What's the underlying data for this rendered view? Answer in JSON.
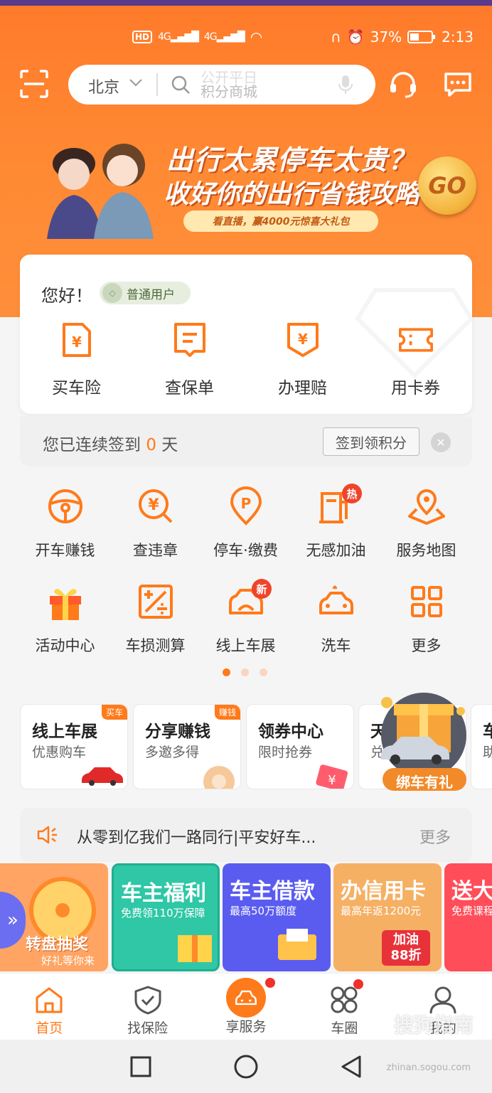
{
  "status_bar": {
    "left_badges": [
      "HD",
      "4G",
      "4G"
    ],
    "battery": "37%",
    "time": "2:13"
  },
  "top_nav": {
    "city": "北京",
    "search_placeholder_line1": "公开平日",
    "search_placeholder_line2": "积分商城"
  },
  "banner": {
    "line1": "出行太累停车太贵？",
    "line2": "收好你的出行省钱攻略",
    "pill": "看直播，赢4000元惊喜大礼包",
    "go": "GO"
  },
  "user_card": {
    "greeting": "您好！",
    "level": "普通用户",
    "actions": [
      {
        "label": "买车险",
        "icon": "receipt-yen-icon"
      },
      {
        "label": "查保单",
        "icon": "policy-icon"
      },
      {
        "label": "办理赔",
        "icon": "shield-yen-icon"
      },
      {
        "label": "用卡券",
        "icon": "ticket-icon"
      }
    ]
  },
  "signin": {
    "prefix": "您已连续签到 ",
    "days": "0",
    "suffix": " 天",
    "button": "签到领积分"
  },
  "services": [
    [
      {
        "label": "开车赚钱",
        "icon": "steering-wheel-icon"
      },
      {
        "label": "查违章",
        "icon": "violation-search-icon"
      },
      {
        "label": "停车·缴费",
        "icon": "parking-icon"
      },
      {
        "label": "无感加油",
        "icon": "fuel-pump-icon",
        "badge": "热"
      },
      {
        "label": "服务地图",
        "icon": "map-pin-icon"
      }
    ],
    [
      {
        "label": "活动中心",
        "icon": "gift-box-icon"
      },
      {
        "label": "车损测算",
        "icon": "calculator-icon"
      },
      {
        "label": "线上车展",
        "icon": "car-show-icon",
        "badge": "新"
      },
      {
        "label": "洗车",
        "icon": "car-wash-icon"
      },
      {
        "label": "更多",
        "icon": "grid-more-icon"
      }
    ]
  ],
  "promos": [
    {
      "title": "线上车展",
      "sub": "优惠购车",
      "tag": "买车"
    },
    {
      "title": "分享赚钱",
      "sub": "多邀多得",
      "tag": "赚钱"
    },
    {
      "title": "领券中心",
      "sub": "限时抢券",
      "tag": ""
    },
    {
      "title": "天",
      "sub": "兑",
      "tag": ""
    },
    {
      "title": "车",
      "sub": "助",
      "tag": ""
    }
  ],
  "bind_car": "绑车有礼",
  "notice": {
    "text": "从零到亿我们一路同行|平安好车...",
    "more": "更多"
  },
  "bottom_banners": [
    {
      "title": "转盘抽奖",
      "sub": "好礼等你来",
      "color": "#ffa463"
    },
    {
      "title": "车主福利",
      "sub": "免费领110万保障",
      "color": "#2fc7a6"
    },
    {
      "title": "车主借款",
      "sub": "最高50万额度",
      "color": "#5a5cf0"
    },
    {
      "title": "办信用卡",
      "sub": "最高年返1200元",
      "color": "#f5b064",
      "extra1": "加油",
      "extra2": "88折"
    },
    {
      "title": "送大",
      "sub": "免费课程",
      "color": "#ff4d5a"
    }
  ],
  "tabs": [
    {
      "label": "首页",
      "icon": "home-icon",
      "active": true
    },
    {
      "label": "找保险",
      "icon": "shield-check-icon"
    },
    {
      "label": "享服务",
      "icon": "car-icon",
      "dot": true
    },
    {
      "label": "车圈",
      "icon": "community-icon",
      "dot": true
    },
    {
      "label": "我的",
      "icon": "person-icon"
    }
  ],
  "watermark": "搜狗指南",
  "watermark_sub": "zhinan.sogou.com",
  "colors": {
    "brand": "#ff7a1a",
    "badge_red": "#f0442a"
  }
}
